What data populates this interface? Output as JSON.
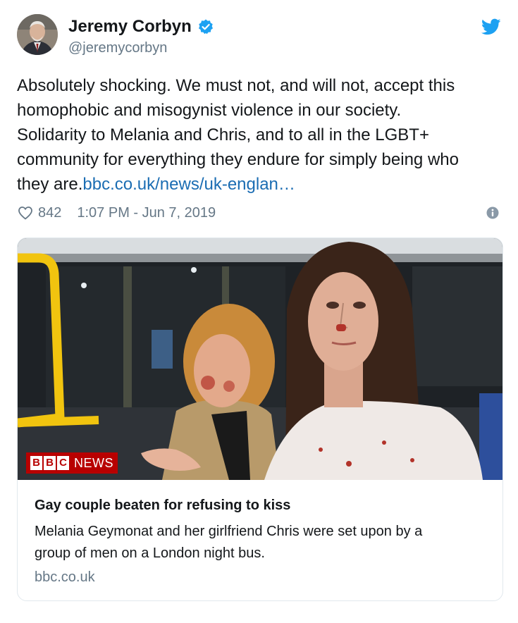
{
  "author": {
    "name": "Jeremy Corbyn",
    "handle": "@jeremycorbyn",
    "verified": true,
    "avatar_icon": "avatar-photo"
  },
  "tweet": {
    "text_lines": [
      "Absolutely shocking. We must not, and will not, accept this",
      "homophobic and misogynist violence in our society.",
      "Solidarity to Melania and Chris, and to all in the LGBT+",
      "community for everything they endure for simply being who"
    ],
    "last_line_text": "they are.",
    "link_text": "bbc.co.uk/news/uk-englan…",
    "likes": "842",
    "timestamp": "1:07 PM - Jun 7, 2019"
  },
  "card": {
    "badge": {
      "letters": [
        "B",
        "B",
        "C"
      ],
      "label": "NEWS"
    },
    "title": "Gay couple beaten for refusing to kiss",
    "description_lines": [
      "Melania Geymonat and her girlfriend Chris were set upon by a",
      "group of men on a London night bus."
    ],
    "domain": "bbc.co.uk"
  },
  "colors": {
    "twitter_blue": "#1da1f2",
    "link": "#1b6db3",
    "muted": "#657786",
    "bbc_red": "#b80000"
  },
  "icons": [
    "verified-badge-icon",
    "twitter-bird-icon",
    "heart-icon",
    "info-icon"
  ]
}
